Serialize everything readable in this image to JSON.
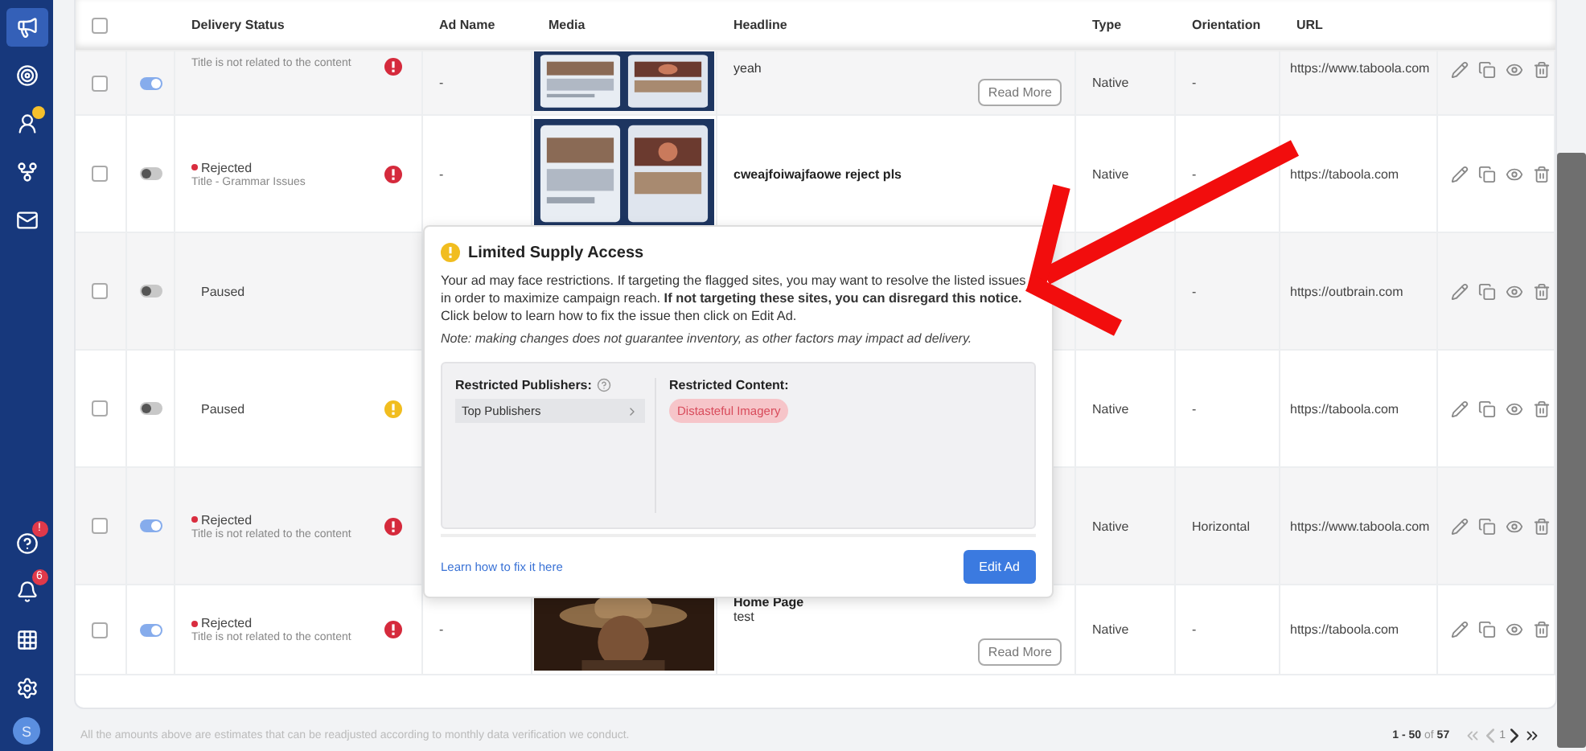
{
  "sidebar": {
    "items": [
      {
        "kind": "megaphone",
        "selected": true
      },
      {
        "kind": "target",
        "selected": false
      },
      {
        "kind": "user",
        "selected": false,
        "dot": true
      },
      {
        "kind": "flow",
        "selected": false
      },
      {
        "kind": "mail",
        "selected": false
      }
    ],
    "bottom": [
      {
        "kind": "help",
        "badge": "!"
      },
      {
        "kind": "bell",
        "badge": "6"
      },
      {
        "kind": "grid"
      },
      {
        "kind": "gear"
      }
    ],
    "avatar": "S"
  },
  "table": {
    "select_all": {
      "checked": false
    },
    "columns": [
      "Delivery Status",
      "Ad Name",
      "Media",
      "Headline",
      "Type",
      "Orientation",
      "URL"
    ],
    "rows": [
      {
        "checked": false,
        "on": true,
        "reason": "Title is not related to the content",
        "alert": {
          "kind": "error"
        },
        "ad_name": "-",
        "media": {
          "kind": "phones"
        },
        "headline": "yeah",
        "read_more": "Read More",
        "type": "Native",
        "orientation": "-",
        "url": "https://www.taboola.com"
      },
      {
        "checked": false,
        "on": false,
        "status": "Rejected",
        "reason": "Title - Grammar Issues",
        "alert": {
          "kind": "error"
        },
        "ad_name": "-",
        "media": {
          "kind": "phones"
        },
        "headline": "cweajfoiwajfaowe reject pls",
        "type": "Native",
        "orientation": "-",
        "url": "https://taboola.com"
      },
      {
        "checked": false,
        "on": false,
        "status": "Paused",
        "orientation": "-",
        "url": "https://outbrain.com"
      },
      {
        "checked": false,
        "on": false,
        "status": "Paused",
        "alert": {
          "kind": "warning"
        },
        "type": "Native",
        "orientation": "-",
        "url": "https://taboola.com"
      },
      {
        "checked": false,
        "on": true,
        "status": "Rejected",
        "reason": "Title is not related to the content",
        "alert": {
          "kind": "error"
        },
        "type": "Native",
        "orientation": "Horizontal",
        "url": "https://www.taboola.com"
      },
      {
        "checked": false,
        "on": true,
        "status": "Rejected",
        "reason": "Title is not related to the content",
        "alert": {
          "kind": "error"
        },
        "ad_name": "-",
        "headline": "Home Page",
        "description": "test",
        "read_more": "Read More",
        "type": "Native",
        "orientation": "-",
        "url": "https://taboola.com"
      }
    ]
  },
  "popover": {
    "title": "Limited Supply Access",
    "body": "Your ad may face restrictions. If targeting the flagged sites, you may want to resolve the listed issues in order to maximize campaign reach. **If not targeting these sites, you can disregard this notice.** Click below to learn how to fix the issue then click on Edit Ad.",
    "note": "Note: making changes does not guarantee inventory, as other factors may impact ad delivery.",
    "publishers_label": "Restricted Publishers:",
    "publishers": [
      "Top Publishers"
    ],
    "content_label": "Restricted Content:",
    "tags": [
      "Distasteful Imagery"
    ],
    "link": "Learn how to fix it here",
    "button": "Edit Ad"
  },
  "footer": {
    "note": "All the amounts above are estimates that can be readjusted according to monthly data verification we conduct.",
    "range": "1 - 50",
    "of": "of",
    "total": "57",
    "page": "1",
    "nav": [
      {
        "kind": "first",
        "disabled": true
      },
      {
        "kind": "prev",
        "disabled": true
      },
      {
        "kind": "next",
        "disabled": false
      },
      {
        "kind": "last",
        "disabled": false
      }
    ]
  }
}
